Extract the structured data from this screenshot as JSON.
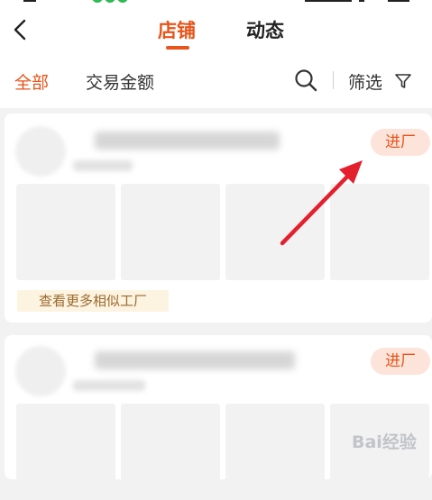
{
  "header": {
    "back_icon": "chevron-left-icon",
    "tabs": [
      {
        "label": "店铺",
        "active": true
      },
      {
        "label": "动态",
        "active": false
      }
    ]
  },
  "filters": {
    "all_label": "全部",
    "amount_label": "交易金额",
    "search_icon": "search-icon",
    "filter_label": "筛选",
    "filter_icon": "funnel-icon"
  },
  "cards": [
    {
      "enter_label": "进厂",
      "more_label": "查看更多相似工厂"
    },
    {
      "enter_label": "进厂"
    }
  ],
  "colors": {
    "accent": "#e8541a",
    "enter_bg": "#fde4da",
    "more_bg": "#fdf3e1",
    "more_text": "#9a6a2c",
    "annotation_arrow": "#e5202e",
    "page_bg": "#f2f2f2"
  },
  "annotation": {
    "arrow_icon": "red-arrow-icon"
  },
  "watermark": {
    "text": "Bai经验"
  }
}
